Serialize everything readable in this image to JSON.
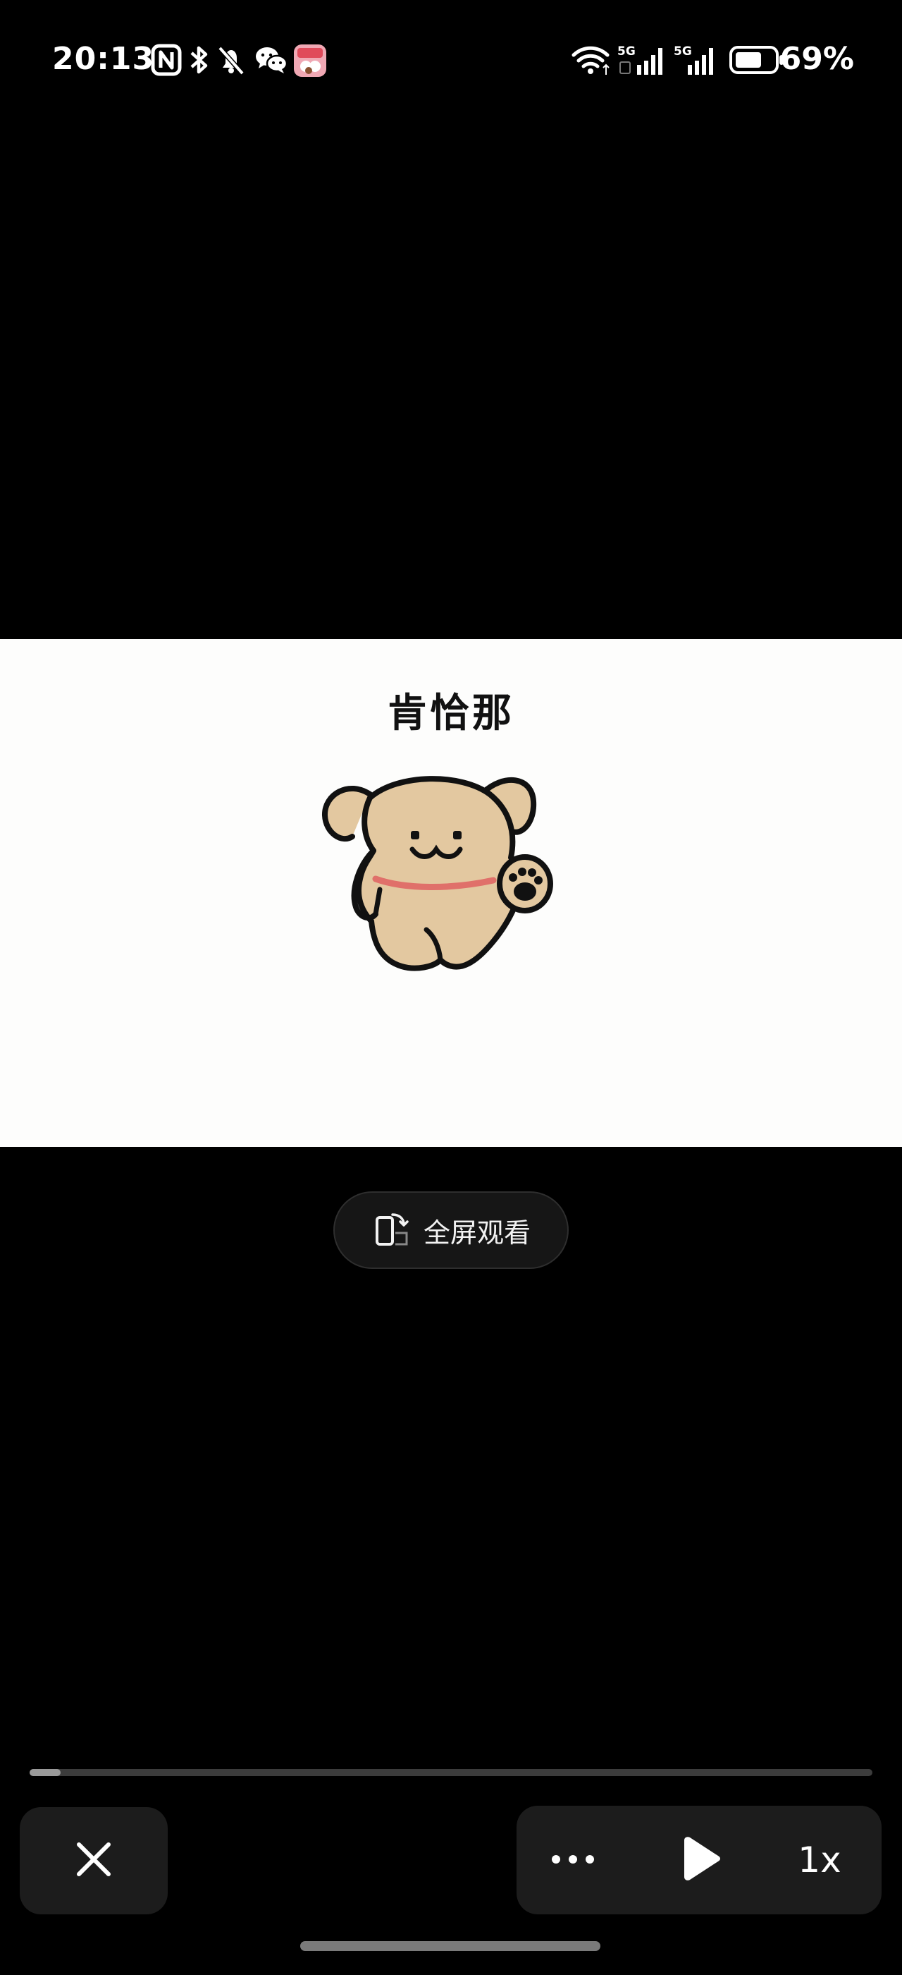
{
  "status_bar": {
    "time": "20:13",
    "battery_percent": "69%",
    "battery_level": 0.69,
    "network_1": "5G",
    "network_2": "5G",
    "icons": [
      "nfc-icon",
      "bluetooth-icon",
      "mute-bell-icon",
      "wechat-icon",
      "app-notification-icon",
      "wifi-icon",
      "signal-5g-icon",
      "signal-5g-icon",
      "battery-icon"
    ]
  },
  "video": {
    "title": "肯恰那",
    "illustration": "waving-dog-icon"
  },
  "fullscreen_button": {
    "label": "全屏观看",
    "icon": "rotate-phone-icon"
  },
  "playback": {
    "progress": 0.037,
    "speed_label": "1x",
    "close_icon": "close-icon",
    "more_icon": "more-dots-icon",
    "play_icon": "play-icon"
  },
  "colors": {
    "background": "#000000",
    "video_bg": "#fdfdfc",
    "dog_fill": "#e3c8a0",
    "collar": "#e0706a",
    "panel_bg": "#1c1c1c"
  }
}
